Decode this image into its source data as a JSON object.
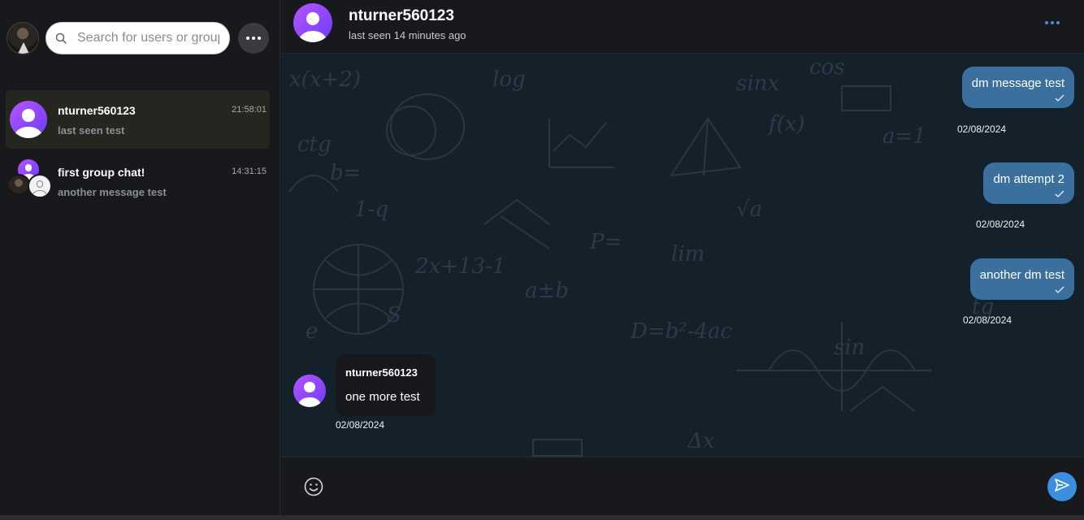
{
  "current_user": {
    "avatar": "user-photo-avatar"
  },
  "search": {
    "placeholder": "Search for users or groups",
    "value": ""
  },
  "sidebar": {
    "chats": [
      {
        "name": "nturner560123",
        "preview": "last seen test",
        "time": "21:58:01",
        "active": true
      },
      {
        "name": "first group chat!",
        "preview": "another message test",
        "time": "14:31:15",
        "active": false
      }
    ]
  },
  "header": {
    "name": "nturner560123",
    "status": "last seen 14 minutes ago"
  },
  "messages": {
    "outgoing": [
      {
        "text": "dm message test",
        "date": "02/08/2024",
        "status": "sent-check-icon"
      },
      {
        "text": "dm attempt 2",
        "date": "02/08/2024",
        "status": "sent-check-icon"
      },
      {
        "text": "another dm test",
        "date": "02/08/2024",
        "status": "sent-check-icon"
      }
    ],
    "incoming": [
      {
        "sender": "nturner560123",
        "text": "one more test",
        "date": "02/08/2024"
      }
    ]
  },
  "composer": {
    "placeholder": "",
    "value": ""
  },
  "colors": {
    "outgoing_bubble": "#3a6f9e",
    "accent": "#3b8ee0",
    "avatar_gradient_start": "#b455ff",
    "avatar_gradient_end": "#6f3bff",
    "active_chat_bg": "#25261f"
  },
  "background_words": [
    "x(x+2)",
    "log",
    "sinx",
    "cos",
    "a=1",
    "f(x)",
    "lim",
    "tg",
    "ctg",
    "b=",
    "2x+13-1",
    "e",
    "D=b²-4ac",
    "sin",
    "√a",
    "a±b",
    "P=",
    "S",
    "Δx",
    "1-q"
  ]
}
